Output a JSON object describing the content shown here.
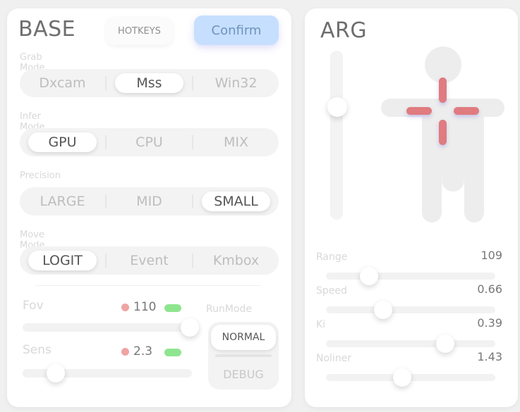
{
  "base": {
    "title": "BASE",
    "hotkeys_label": "HOTKEYS",
    "confirm_label": "Confirm",
    "sections": [
      {
        "label": "Grab Mode",
        "options": [
          "Dxcam",
          "Mss",
          "Win32"
        ],
        "selected": "Mss"
      },
      {
        "label": "Infer Mode",
        "options": [
          "GPU",
          "CPU",
          "MIX"
        ],
        "selected": "GPU"
      },
      {
        "label": "Precision",
        "options": [
          "LARGE",
          "MID",
          "SMALL"
        ],
        "selected": "SMALL"
      },
      {
        "label": "Move Mode",
        "options": [
          "LOGIT",
          "Event",
          "Kmbox"
        ],
        "selected": "LOGIT"
      }
    ],
    "fov": {
      "label": "Fov",
      "value": "110",
      "fraction": 1.0
    },
    "sens": {
      "label": "Sens",
      "value": "2.3",
      "fraction": 0.15
    },
    "runmode": {
      "label": "RunMode",
      "options": [
        "NORMAL",
        "DEBUG"
      ],
      "selected": "NORMAL"
    },
    "colors": {
      "dot": "#f0a3a3",
      "pill": "#8fe58f",
      "confirm_bg": "#c6dfff"
    }
  },
  "arg": {
    "title": "ARG",
    "vertical_slider_fraction": 0.3,
    "sliders": [
      {
        "label": "Range",
        "value": "109",
        "fraction": 0.22
      },
      {
        "label": "Speed",
        "value": "0.66",
        "fraction": 0.31
      },
      {
        "label": "Ki",
        "value": "0.39",
        "fraction": 0.71
      },
      {
        "label": "Noliner",
        "value": "1.43",
        "fraction": 0.43
      }
    ],
    "crosshair_color": "#e07b7f"
  }
}
